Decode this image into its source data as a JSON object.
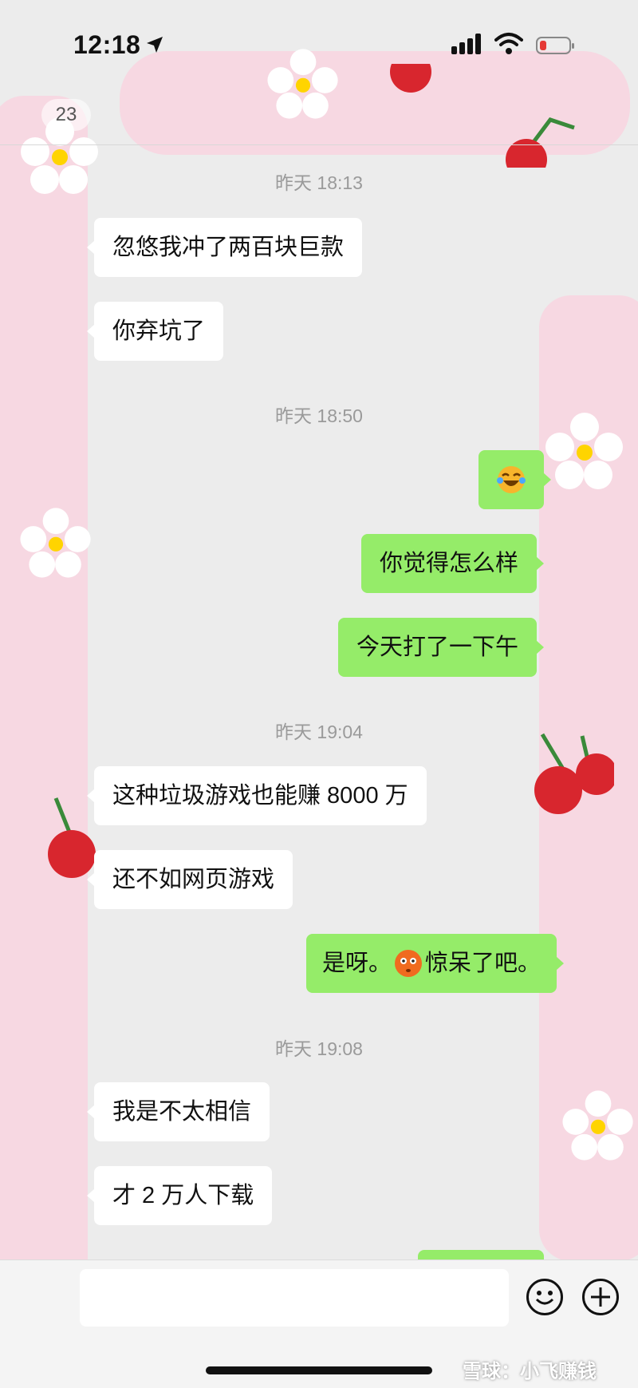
{
  "status_bar": {
    "time": "12:18",
    "battery_color": "#e53935"
  },
  "nav": {
    "unread_count": "23"
  },
  "messages": [
    {
      "type": "time",
      "text": "昨天 18:13"
    },
    {
      "type": "left",
      "text": "忽悠我冲了两百块巨款"
    },
    {
      "type": "left",
      "text": "你弃坑了"
    },
    {
      "type": "time",
      "text": "昨天 18:50"
    },
    {
      "type": "right",
      "emoji": "laughing-tears-emoji"
    },
    {
      "type": "right",
      "text": "你觉得怎么样"
    },
    {
      "type": "right",
      "text": "今天打了一下午"
    },
    {
      "type": "time",
      "text": "昨天 19:04"
    },
    {
      "type": "left",
      "text": "这种垃圾游戏也能赚 8000 万"
    },
    {
      "type": "left",
      "text": "还不如网页游戏"
    },
    {
      "type": "right",
      "text_before": "是呀。",
      "emoji": "stunned-face-emoji",
      "text_after": "惊呆了吧。"
    },
    {
      "type": "time",
      "text": "昨天 19:08"
    },
    {
      "type": "left",
      "text": "我是不太相信"
    },
    {
      "type": "left",
      "text": "才 2 万人下载"
    }
  ],
  "input_bar": {
    "emoji_icon": "smiley-icon",
    "plus_icon": "plus-icon"
  },
  "watermark": "雪球：小飞赚钱",
  "colors": {
    "left_bubble": "#ffffff",
    "right_bubble": "#95ec69",
    "background": "#ececec",
    "overlay_pink": "#f7d6e1"
  }
}
